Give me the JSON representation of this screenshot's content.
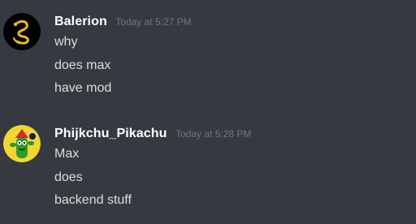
{
  "messages": [
    {
      "author": "Balerion",
      "timestamp": "Today at 5:27 PM",
      "lines": [
        "why",
        "does max",
        "have mod"
      ],
      "avatar_icon": "golden-serpent-icon",
      "avatar_colors": {
        "bg": "#000000",
        "fg": "#e9b824"
      }
    },
    {
      "author": "Phijkchu_Pikachu",
      "timestamp": "Today at 5:28 PM",
      "lines": [
        "Max",
        "does",
        "backend stuff"
      ],
      "avatar_icon": "cactus-character-icon",
      "avatar_colors": {
        "bg": "#f1d634",
        "fg": "#2e9a2a",
        "accent": "#d22a2a"
      }
    }
  ],
  "colors": {
    "background": "#36393f",
    "username": "#ffffff",
    "timestamp": "#72767d",
    "message_text": "#dcddde"
  }
}
